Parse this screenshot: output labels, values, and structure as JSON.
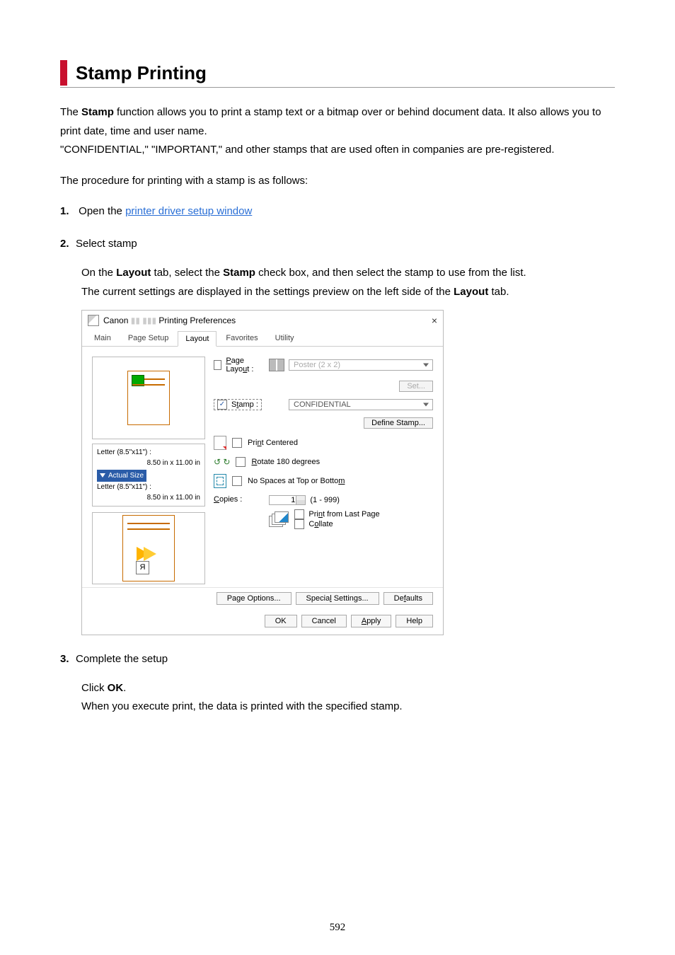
{
  "title": "Stamp Printing",
  "intro1": "The Stamp function allows you to print a stamp text or a bitmap over or behind document data. It also allows you to print date, time and user name.",
  "intro2": "\"CONFIDENTIAL,\" \"IMPORTANT,\" and other stamps that are used often in companies are pre-registered.",
  "intro3": "The procedure for printing with a stamp is as follows:",
  "steps": {
    "s1": {
      "head": "Open the ",
      "link_text": "printer driver setup window"
    },
    "s2": {
      "head": "Select stamp",
      "body_a": "On the Layout tab, select the Stamp check box, and then select the stamp to use from the list.",
      "body_b": "The current settings are displayed in the settings preview on the left side of the Layout tab."
    },
    "s3": {
      "head": "Complete the setup",
      "body_a": "Click OK.",
      "body_b": "When you execute print, the data is printed with the specified stamp."
    }
  },
  "dialog": {
    "title_prefix": "Canon",
    "title_suffix": " Printing Preferences",
    "tabs": [
      "Main",
      "Page Setup",
      "Layout",
      "Favorites",
      "Utility"
    ],
    "left": {
      "paper1_name": "Letter (8.5\"x11\") :",
      "paper1_size": "8.50 in x 11.00 in",
      "actual_size": "Actual Size",
      "paper2_name": "Letter (8.5\"x11\") :",
      "paper2_size": "8.50 in x 11.00 in"
    },
    "controls": {
      "page_layout_label": "Page Layout :",
      "page_layout_value": "Poster (2 x 2)",
      "set_btn": "Set...",
      "stamp_label": "Stamp :",
      "stamp_value": "CONFIDENTIAL",
      "define_stamp": "Define Stamp...",
      "print_centered": "Print Centered",
      "rotate180": "Rotate 180 degrees",
      "no_spaces": "No Spaces at Top or Bottom",
      "copies_label": "Copies :",
      "copies_value": "1",
      "copies_range": "(1 - 999)",
      "last_page": "Print from Last Page",
      "collate": "Collate"
    },
    "mid_buttons": [
      "Page Options...",
      "Special Settings...",
      "Defaults"
    ],
    "bottom_buttons": [
      "OK",
      "Cancel",
      "Apply",
      "Help"
    ]
  },
  "page_number": "592"
}
